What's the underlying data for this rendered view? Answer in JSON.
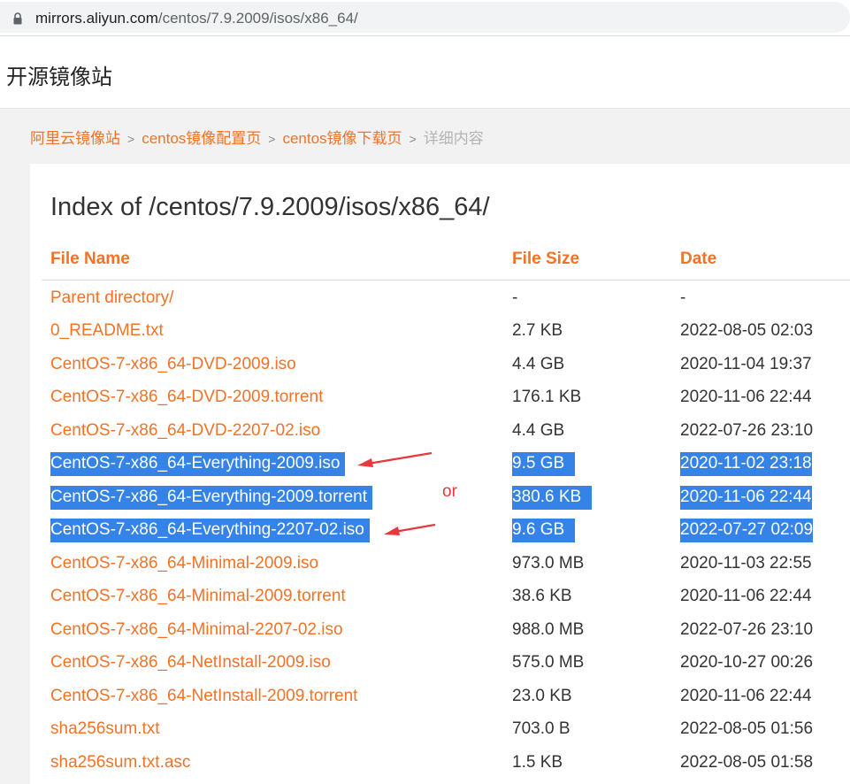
{
  "browser": {
    "url_host": "mirrors.aliyun.com",
    "url_path": "/centos/7.9.2009/isos/x86_64/",
    "lock_icon": "lock-icon"
  },
  "header": {
    "site_title": "开源镜像站"
  },
  "breadcrumb": {
    "items": [
      "阿里云镜像站",
      "centos镜像配置页",
      "centos镜像下载页"
    ],
    "current": "详细内容",
    "separator": ">"
  },
  "listing": {
    "title": "Index of /centos/7.9.2009/isos/x86_64/",
    "columns": [
      "File Name",
      "File Size",
      "Date"
    ],
    "rows": [
      {
        "name": "Parent directory/",
        "size": "-",
        "date": "-"
      },
      {
        "name": "0_README.txt",
        "size": "2.7 KB",
        "date": "2022-08-05 02:03"
      },
      {
        "name": "CentOS-7-x86_64-DVD-2009.iso",
        "size": "4.4 GB",
        "date": "2020-11-04 19:37"
      },
      {
        "name": "CentOS-7-x86_64-DVD-2009.torrent",
        "size": "176.1 KB",
        "date": "2020-11-06 22:44"
      },
      {
        "name": "CentOS-7-x86_64-DVD-2207-02.iso",
        "size": "4.4 GB",
        "date": "2022-07-26 23:10"
      },
      {
        "name": "CentOS-7-x86_64-Everything-2009.iso",
        "size": "9.5 GB",
        "date": "2020-11-02 23:18"
      },
      {
        "name": "CentOS-7-x86_64-Everything-2009.torrent",
        "size": "380.6 KB",
        "date": "2020-11-06 22:44"
      },
      {
        "name": "CentOS-7-x86_64-Everything-2207-02.iso",
        "size": "9.6 GB",
        "date": "2022-07-27 02:09"
      },
      {
        "name": "CentOS-7-x86_64-Minimal-2009.iso",
        "size": "973.0 MB",
        "date": "2020-11-03 22:55"
      },
      {
        "name": "CentOS-7-x86_64-Minimal-2009.torrent",
        "size": "38.6 KB",
        "date": "2020-11-06 22:44"
      },
      {
        "name": "CentOS-7-x86_64-Minimal-2207-02.iso",
        "size": "988.0 MB",
        "date": "2022-07-26 23:10"
      },
      {
        "name": "CentOS-7-x86_64-NetInstall-2009.iso",
        "size": "575.0 MB",
        "date": "2020-10-27 00:26"
      },
      {
        "name": "CentOS-7-x86_64-NetInstall-2009.torrent",
        "size": "23.0 KB",
        "date": "2020-11-06 22:44"
      },
      {
        "name": "sha256sum.txt",
        "size": "703.0 B",
        "date": "2022-08-05 01:56"
      },
      {
        "name": "sha256sum.txt.asc",
        "size": "1.5 KB",
        "date": "2022-08-05 01:58"
      }
    ],
    "selected_rows": [
      5,
      6,
      7
    ]
  },
  "annotation": {
    "or_text": "or",
    "color": "#e8383d"
  },
  "colors": {
    "accent": "#f27226",
    "selection": "#3583e6",
    "muted": "#b4b4b4"
  }
}
